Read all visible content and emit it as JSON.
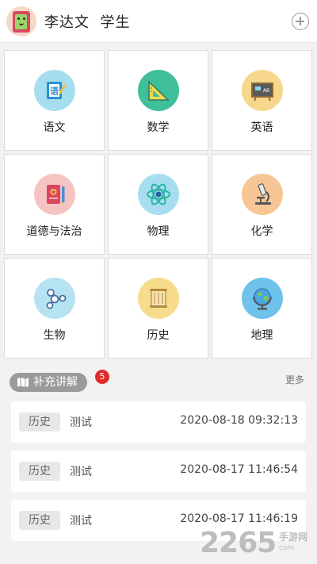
{
  "header": {
    "user_name": "李达文  学生",
    "avatar_icon": "book-mascot-icon",
    "add_icon": "plus-circle-icon"
  },
  "subjects": [
    {
      "label": "语文",
      "icon": "chinese-book-icon",
      "bg": "#a6def0"
    },
    {
      "label": "数学",
      "icon": "set-square-icon",
      "bg": "#3fbf9a"
    },
    {
      "label": "英语",
      "icon": "blackboard-icon",
      "bg": "#f7d78c"
    },
    {
      "label": "道德与法治",
      "icon": "notebook-pen-icon",
      "bg": "#f6c3c3"
    },
    {
      "label": "物理",
      "icon": "atom-icon",
      "bg": "#a6def0"
    },
    {
      "label": "化学",
      "icon": "microscope-icon",
      "bg": "#f7c694"
    },
    {
      "label": "生物",
      "icon": "molecule-icon",
      "bg": "#b6e3f2"
    },
    {
      "label": "历史",
      "icon": "scroll-icon",
      "bg": "#f7dc8c"
    },
    {
      "label": "地理",
      "icon": "globe-icon",
      "bg": "#6fc2ea"
    }
  ],
  "supplement": {
    "label": "补充讲解",
    "icon": "map-icon",
    "badge": "5",
    "more": "更多"
  },
  "records": [
    {
      "tag": "历史",
      "title": "测试",
      "time": "2020-08-18 09:32:13"
    },
    {
      "tag": "历史",
      "title": "测试",
      "time": "2020-08-17 11:46:54"
    },
    {
      "tag": "历史",
      "title": "测试",
      "time": "2020-08-17 11:46:19"
    }
  ],
  "watermark": {
    "number": "2265",
    "dot": ".",
    "text": "手游网",
    "domain": "com"
  }
}
